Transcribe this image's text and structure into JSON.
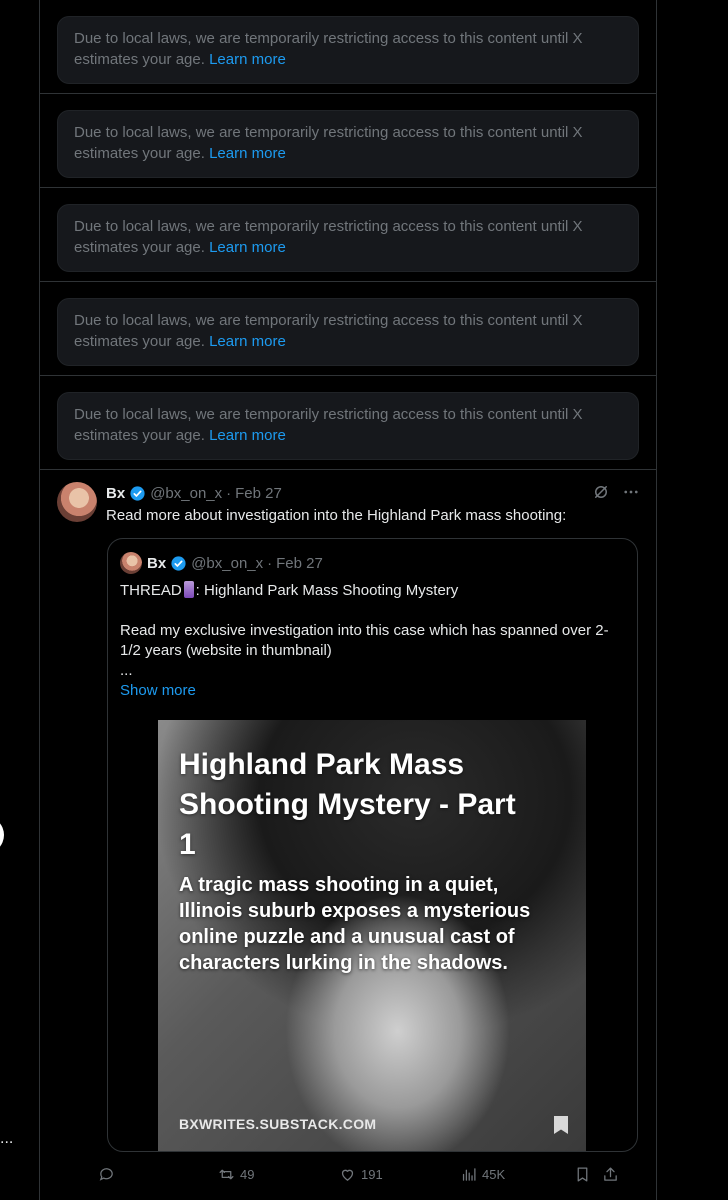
{
  "restricted_notices": [
    {
      "text": "Due to local laws, we are temporarily restricting access to this content until X estimates your age.",
      "link": "Learn more"
    },
    {
      "text": "Due to local laws, we are temporarily restricting access to this content until X estimates your age.",
      "link": "Learn more"
    },
    {
      "text": "Due to local laws, we are temporarily restricting access to this content until X estimates your age.",
      "link": "Learn more"
    },
    {
      "text": "Due to local laws, we are temporarily restricting access to this content until X estimates your age.",
      "link": "Learn more"
    },
    {
      "text": "Due to local laws, we are temporarily restricting access to this content until X estimates your age.",
      "link": "Learn more"
    }
  ],
  "tweet": {
    "name": "Bx",
    "handle": "@bx_on_x",
    "separator": "·",
    "date": "Feb 27",
    "text": "Read more about investigation into the Highland Park mass shooting:",
    "quote": {
      "name": "Bx",
      "handle": "@bx_on_x",
      "separator": "·",
      "date": "Feb 27",
      "thread_prefix": "THREAD",
      "thread_title": ": Highland Park Mass Shooting Mystery",
      "body": "Read my exclusive investigation into this case which has spanned over 2-1/2 years (website in thumbnail)",
      "ellipsis": "...",
      "show_more": "Show more",
      "thumbnail": {
        "title": "Highland Park Mass Shooting Mystery - Part 1",
        "subtitle": "A tragic mass shooting in a quiet, Illinois suburb exposes a mysterious online puzzle and a unusual cast of characters lurking in the shadows.",
        "domain": "BXWRITES.SUBSTACK.COM"
      }
    },
    "stats": {
      "retweets": "49",
      "likes": "191",
      "views": "45K"
    }
  },
  "side": {
    "more_dots": "..."
  },
  "colors": {
    "accent": "#1d9bf0",
    "muted": "#71767b",
    "border": "#2f3336",
    "background": "#000000"
  }
}
